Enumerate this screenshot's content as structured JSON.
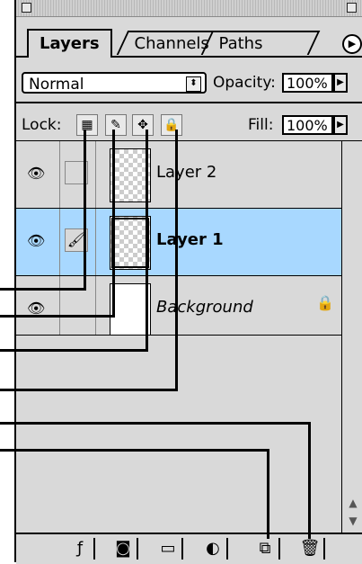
{
  "tabs": [
    {
      "label": "Layers"
    },
    {
      "label": "Channels"
    },
    {
      "label": "Paths"
    }
  ],
  "mode": {
    "value": "Normal"
  },
  "opacity": {
    "label": "Opacity:",
    "value": "100%"
  },
  "lock": {
    "label": "Lock:"
  },
  "fill": {
    "label": "Fill:",
    "value": "100%"
  },
  "layers": [
    {
      "name": "Layer 2",
      "visible": true
    },
    {
      "name": "Layer 1",
      "visible": true,
      "selected": true
    },
    {
      "name": "Background",
      "visible": true,
      "locked": true
    }
  ],
  "icons": {
    "panel_menu": "panel-menu-icon",
    "lock_transparency": "lock-transparency-icon",
    "lock_paint": "lock-paint-icon",
    "lock_position": "lock-position-icon",
    "lock_all": "lock-all-icon",
    "eye": "eye-icon",
    "brush": "brush-icon",
    "padlock": "padlock-icon",
    "add_style": "add-layer-style-icon",
    "add_mask": "add-mask-icon",
    "new_set": "new-set-icon",
    "adjust": "new-adjustment-layer-icon",
    "new_layer": "new-layer-icon",
    "trash": "trash-icon"
  },
  "colors": {
    "selected": "#a8d8ff",
    "panel": "#d9d9d9"
  }
}
